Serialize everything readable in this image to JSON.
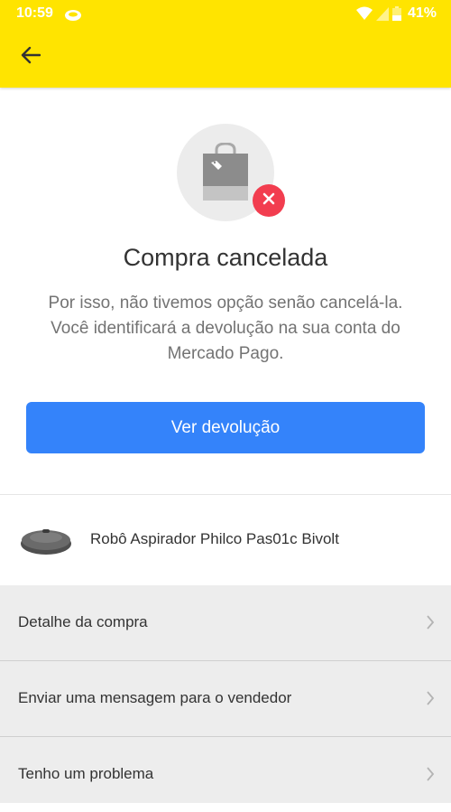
{
  "status_bar": {
    "time": "10:59",
    "battery": "41%",
    "icons": [
      "wifi-icon",
      "signal-icon",
      "battery-icon",
      "notification-icon"
    ]
  },
  "header": {
    "back_icon": "arrow-left-icon",
    "color": "#ffe400"
  },
  "status_card": {
    "icon": "shopping-bag-icon",
    "badge_icon": "close-icon",
    "title": "Compra cancelada",
    "description_lines": [
      "Por isso, não tivemos opção senão cancelá-la.",
      "Você identificará a devolução na sua conta do",
      "Mercado Pago."
    ],
    "button_label": "Ver devolução",
    "button_color": "#3483fa",
    "badge_color": "#f23d4f"
  },
  "product": {
    "name": "Robô Aspirador Philco Pas01c Bivolt",
    "image": "robot-vacuum-image"
  },
  "menu": [
    {
      "label": "Detalhe da compra"
    },
    {
      "label": "Enviar uma mensagem para o vendedor"
    },
    {
      "label": "Tenho um problema"
    }
  ]
}
